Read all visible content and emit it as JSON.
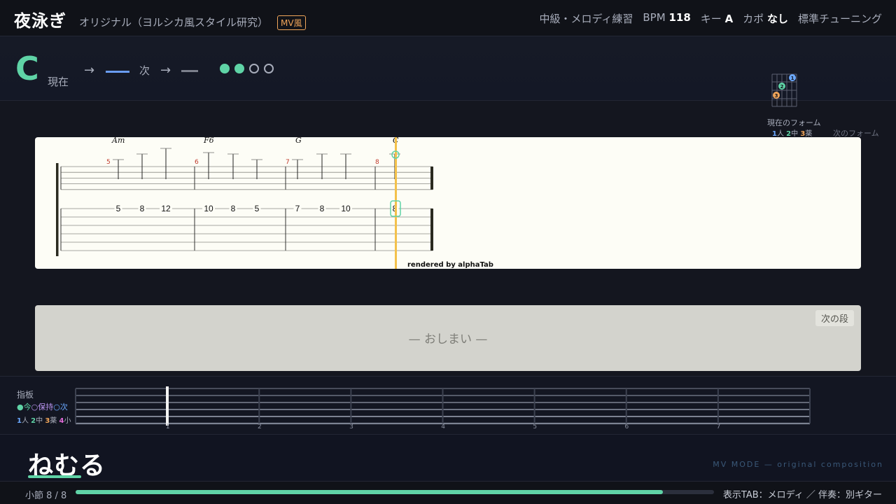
{
  "header": {
    "title": "夜泳ぎ",
    "subtitle": "オリジナル（ヨルシカ風スタイル研究）",
    "badge": "MV風",
    "level": "中級・メロディ練習",
    "bpm_label": "BPM",
    "bpm_value": "118",
    "key_label": "キー",
    "key_value": "A",
    "capo_label": "カポ",
    "capo_value": "なし",
    "tuning": "標準チューニング"
  },
  "chord_bar": {
    "current_chord": "C",
    "current_label": "現在",
    "arrow": "→",
    "next_label": "次",
    "beats_total": 4,
    "beats_active": 2,
    "diagram_fingers": [
      "1",
      "2",
      "3"
    ],
    "form_now_label": "現在のフォーム",
    "form_legend": {
      "f1": "1",
      "f1_label": "人",
      "f2": "2",
      "f2_label": "中",
      "f3": "3",
      "f3_label": "薬"
    },
    "form_next_label": "次のフォーム",
    "colors": {
      "accent": "#5fd3a6",
      "finger1": "#6aa8ff",
      "finger2": "#5fd3a6",
      "finger3": "#f0a55a"
    }
  },
  "score": {
    "measures": [
      {
        "number": "5",
        "chord": "Am",
        "frets": [
          "5",
          "8",
          "12"
        ]
      },
      {
        "number": "6",
        "chord": "F6",
        "frets": [
          "10",
          "8",
          "5"
        ]
      },
      {
        "number": "7",
        "chord": "G",
        "frets": [
          "7",
          "8",
          "10"
        ]
      },
      {
        "number": "8",
        "chord": "C",
        "frets": [
          "8"
        ]
      }
    ],
    "rendered_by": "rendered by alphaTab"
  },
  "next_panel": {
    "end_text": "— おしまい —",
    "next_step_label": "次の段"
  },
  "fretboard": {
    "title": "指板",
    "legend_now": "●今",
    "legend_hold": "○保持",
    "legend_next": "○次",
    "fingers": [
      {
        "num": "1",
        "label": "人"
      },
      {
        "num": "2",
        "label": "中"
      },
      {
        "num": "3",
        "label": "薬"
      },
      {
        "num": "4",
        "label": "小"
      }
    ],
    "fret_numbers": [
      "1",
      "2",
      "3",
      "4",
      "5",
      "6",
      "7"
    ]
  },
  "lyrics": {
    "current": "ねむる",
    "mv_mode": "MV MODE — original composition"
  },
  "bottom": {
    "measure_label": "小節 8 / 8",
    "progress": 0.92,
    "display_info": "表示TAB：メロディ ／ 伴奏：別ギター"
  }
}
